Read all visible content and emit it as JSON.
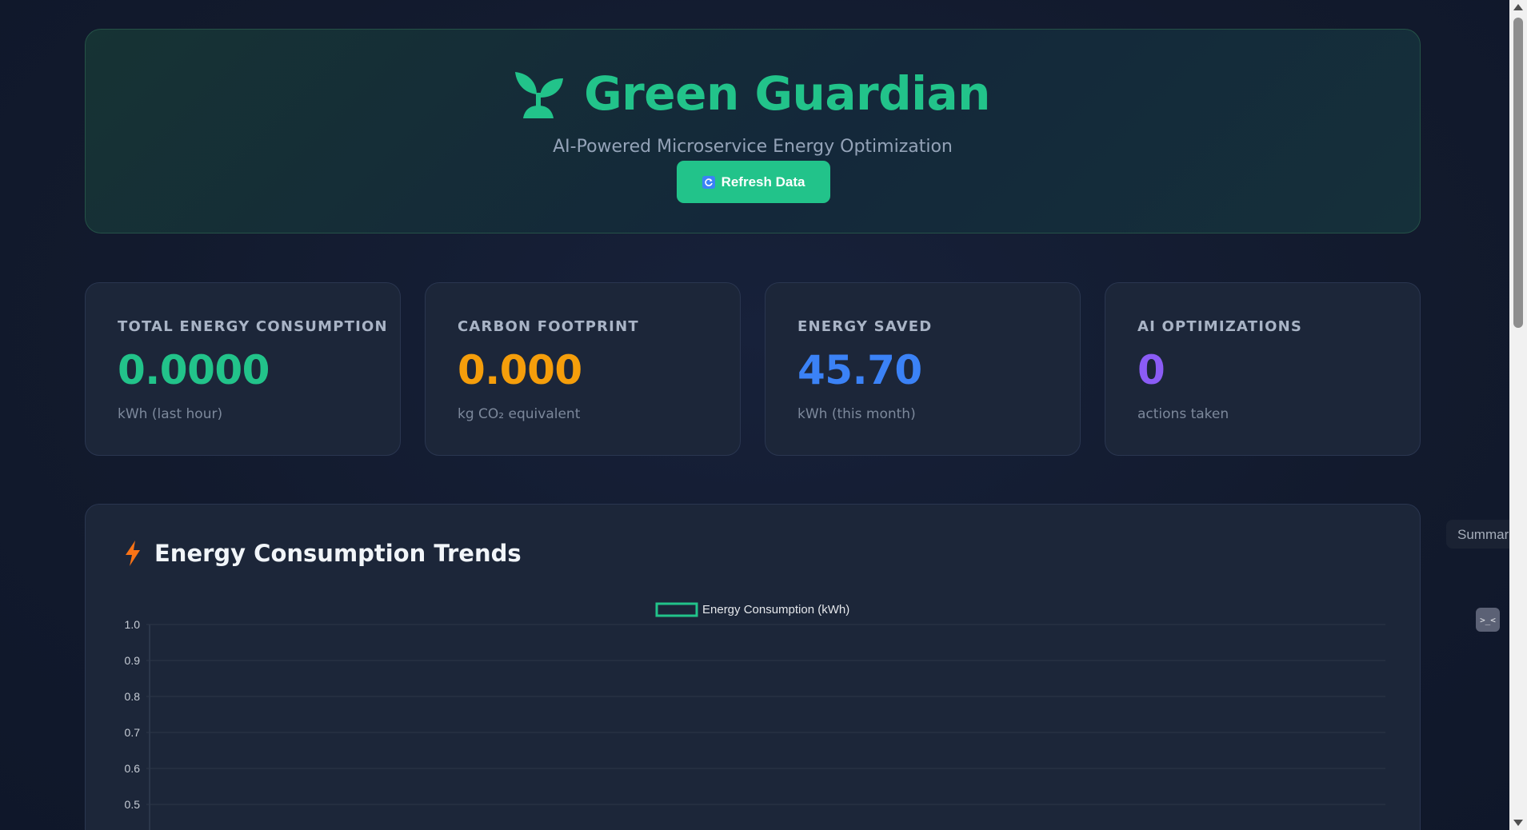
{
  "header": {
    "title": "Green Guardian",
    "subtitle": "AI-Powered Microservice Energy Optimization",
    "refresh_label": "Refresh Data",
    "brand_color": "#22c38a"
  },
  "stats": [
    {
      "label": "Total Energy Consumption",
      "value": "0.0000",
      "unit": "kWh (last hour)",
      "color": "#22c38a"
    },
    {
      "label": "Carbon Footprint",
      "value": "0.000",
      "unit": "kg CO₂ equivalent",
      "color": "#f59e0b"
    },
    {
      "label": "Energy Saved",
      "value": "45.70",
      "unit": "kWh (this month)",
      "color": "#3b82f6"
    },
    {
      "label": "AI Optimizations",
      "value": "0",
      "unit": "actions taken",
      "color": "#8b5cf6"
    }
  ],
  "chart_section": {
    "title": "Energy Consumption Trends",
    "icon": "lightning-icon"
  },
  "chart_data": {
    "type": "line",
    "title": "",
    "xlabel": "",
    "ylabel": "",
    "series": [
      {
        "name": "Energy Consumption (kWh)",
        "values": [],
        "color": "#22c38a"
      }
    ],
    "ylim": [
      0,
      1.0
    ],
    "y_ticks": [
      "1.0",
      "0.9",
      "0.8",
      "0.7",
      "0.6",
      "0.5"
    ],
    "grid": true,
    "legend": "top-center"
  },
  "side_panel": {
    "summary_label": "Summar"
  },
  "widget": {
    "icon_text": ">_<"
  }
}
